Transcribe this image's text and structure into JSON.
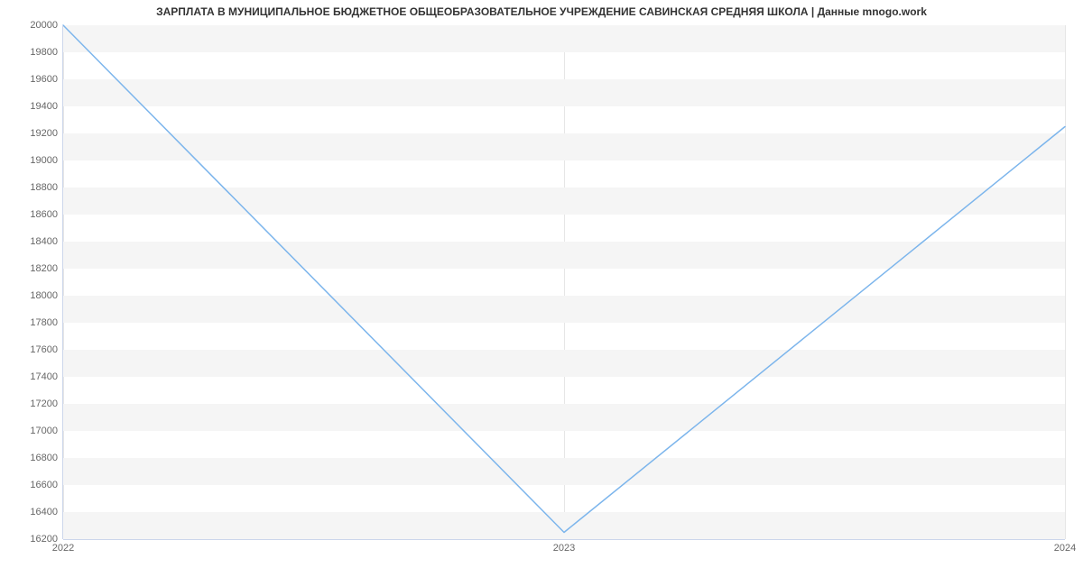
{
  "chart_data": {
    "type": "line",
    "title": "ЗАРПЛАТА В МУНИЦИПАЛЬНОЕ БЮДЖЕТНОЕ ОБЩЕОБРАЗОВАТЕЛЬНОЕ УЧРЕЖДЕНИЕ САВИНСКАЯ СРЕДНЯЯ ШКОЛА | Данные mnogo.work",
    "xlabel": "",
    "ylabel": "",
    "x": [
      "2022",
      "2023",
      "2024"
    ],
    "values": [
      20000,
      16250,
      19250
    ],
    "ylim": [
      16200,
      20000
    ],
    "y_ticks": [
      16200,
      16400,
      16600,
      16800,
      17000,
      17200,
      17400,
      17600,
      17800,
      18000,
      18200,
      18400,
      18600,
      18800,
      19000,
      19200,
      19400,
      19600,
      19800,
      20000
    ],
    "x_ticks": [
      "2022",
      "2023",
      "2024"
    ],
    "grid": true,
    "series_color": "#7cb5ec"
  }
}
